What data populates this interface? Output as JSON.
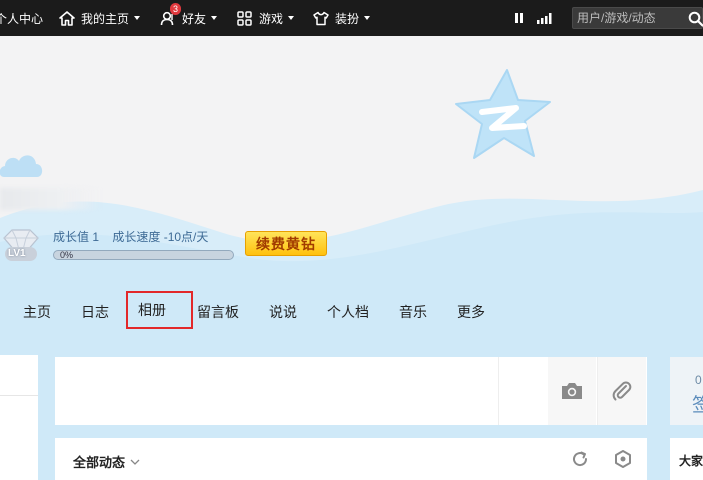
{
  "topbar": {
    "personal_center": "个人中心",
    "my_home": "我的主页",
    "friends": "好友",
    "friends_badge": "3",
    "games": "游戏",
    "dressup": "装扮",
    "search_placeholder": "用户/游戏/动态"
  },
  "header": {
    "level_label": "LV1",
    "growth_value": "成长值 1",
    "growth_speed": "成长速度 -10点/天",
    "progress_text": "0%",
    "progress_fraction": 0.0,
    "renew_button": "续费黄钻"
  },
  "nav": {
    "items": [
      "主页",
      "日志",
      "相册",
      "留言板",
      "说说",
      "个人档",
      "音乐",
      "更多"
    ],
    "highlighted": "相册"
  },
  "feed": {
    "filter_label": "全部动态"
  },
  "right": {
    "partial_number": "0",
    "partial_sign": "签",
    "partial_heading": "大家"
  },
  "colors": {
    "topbar": "#1b1b1b",
    "banner_bg": "#f3f3f4",
    "wave": "#cfe9f8",
    "renew_button": "#ffc10f",
    "highlight_box": "#e2282a"
  }
}
